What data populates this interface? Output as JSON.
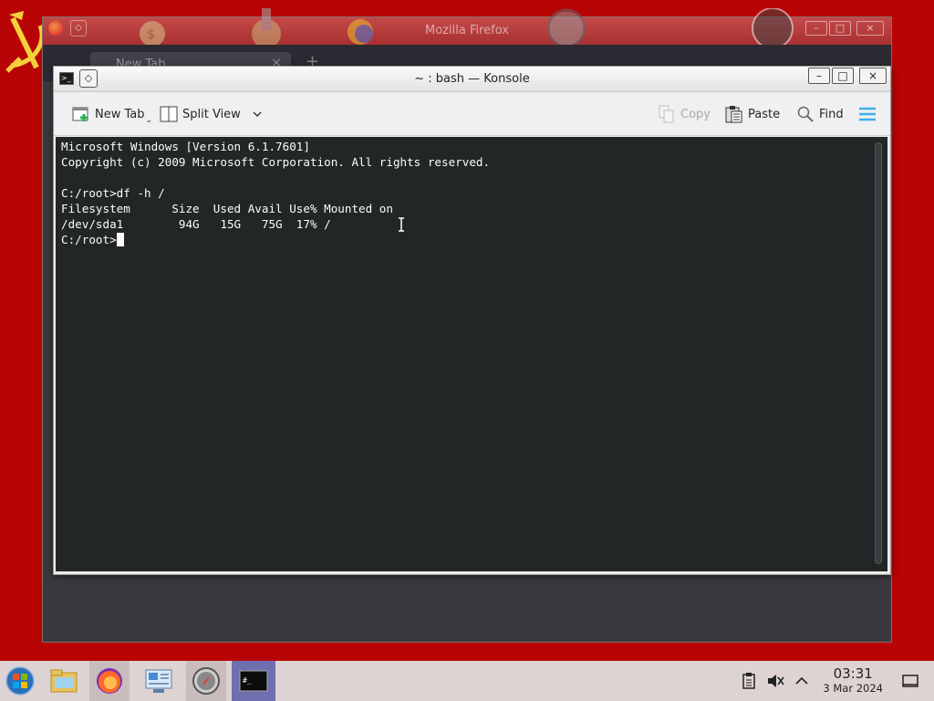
{
  "background_window": {
    "title": "Mozilla Firefox",
    "tab_label": "New Tab",
    "tab_close": "×",
    "new_tab_glyph": "+",
    "controls": {
      "minimize": "–",
      "maximize": "□",
      "close": "×"
    }
  },
  "konsole": {
    "title": "~ : bash — Konsole",
    "icon_text": ">_",
    "controls": {
      "minimize": "–",
      "maximize": "□",
      "close": "×"
    },
    "toolbar": {
      "new_tab": "New Tab",
      "split_view": "Split View",
      "copy": "Copy",
      "paste": "Paste",
      "find": "Find"
    },
    "terminal": {
      "lines": [
        "Microsoft Windows [Version 6.1.7601]",
        "Copyright (c) 2009 Microsoft Corporation. All rights reserved.",
        "",
        "C:/root>df -h /",
        "Filesystem      Size  Used Avail Use% Mounted on",
        "/dev/sda1        94G   15G   75G  17% /",
        "C:/root>"
      ],
      "background": "#232627",
      "foreground": "#fcfcfc"
    }
  },
  "taskbar": {
    "apps": [
      "start-orb-icon",
      "file-manager-icon",
      "firefox-icon",
      "system-settings-icon",
      "safari-compass-icon",
      "konsole-icon"
    ],
    "tray": [
      "clipboard-icon",
      "volume-muted-icon",
      "chevron-up-icon",
      "show-desktop-icon"
    ],
    "clock_time": "03:31",
    "clock_date": "3 Mar 2024"
  },
  "colors": {
    "desktop": "#b80404",
    "taskbar": "#ded3d3",
    "accent": "#3daee9"
  }
}
